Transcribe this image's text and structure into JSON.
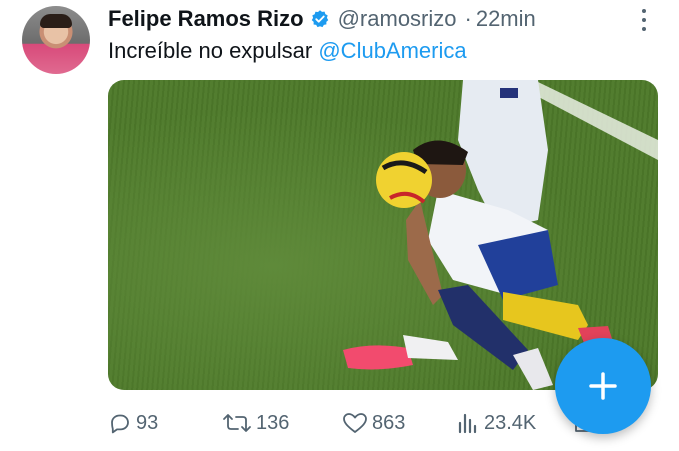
{
  "tweet": {
    "author_name": "Felipe Ramos Rizo",
    "handle": "@ramosrizo",
    "separator": "·",
    "time": "22min",
    "text_plain": "Increíble no expulsar ",
    "text_mention": "@ClubAmerica"
  },
  "actions": {
    "replies": "93",
    "retweets": "136",
    "likes": "863",
    "views": "23.4K"
  },
  "icons": {
    "verified": "verified-badge-icon",
    "more": "more-options-icon",
    "reply": "reply-icon",
    "retweet": "retweet-icon",
    "like": "like-icon",
    "views": "views-icon",
    "share": "share-icon",
    "compose": "compose-plus-icon"
  },
  "colors": {
    "accent": "#1d9bf0",
    "text": "#0f1419",
    "secondary": "#536471"
  }
}
